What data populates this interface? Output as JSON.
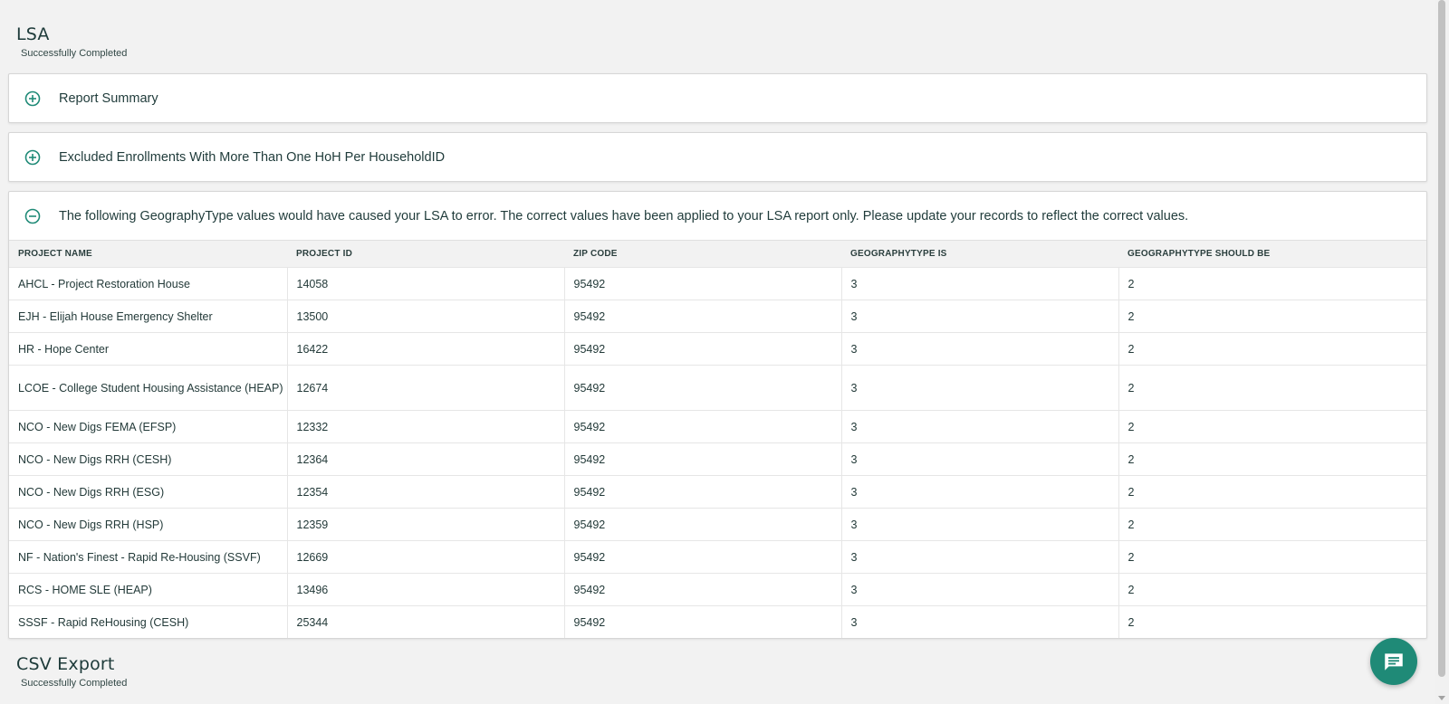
{
  "lsa": {
    "title": "LSA",
    "status": "Successfully Completed"
  },
  "panels": {
    "report_summary": {
      "title": "Report Summary",
      "expanded": false
    },
    "excluded": {
      "title": "Excluded Enrollments With More Than One HoH Per HouseholdID",
      "expanded": false
    },
    "geography": {
      "title": "The following GeographyType values would have caused your LSA to error. The correct values have been applied to your LSA report only. Please update your records to reflect the correct values.",
      "expanded": true
    }
  },
  "table": {
    "headers": [
      "PROJECT NAME",
      "PROJECT ID",
      "ZIP CODE",
      "GEOGRAPHYTYPE IS",
      "GEOGRAPHYTYPE SHOULD BE"
    ],
    "rows": [
      [
        "AHCL - Project Restoration House",
        "14058",
        "95492",
        "3",
        "2"
      ],
      [
        "EJH - Elijah House Emergency Shelter",
        "13500",
        "95492",
        "3",
        "2"
      ],
      [
        "HR - Hope Center",
        "16422",
        "95492",
        "3",
        "2"
      ],
      [
        "LCOE - College Student Housing Assistance (HEAP)",
        "12674",
        "95492",
        "3",
        "2"
      ],
      [
        "NCO - New Digs FEMA (EFSP)",
        "12332",
        "95492",
        "3",
        "2"
      ],
      [
        "NCO - New Digs RRH (CESH)",
        "12364",
        "95492",
        "3",
        "2"
      ],
      [
        "NCO - New Digs RRH (ESG)",
        "12354",
        "95492",
        "3",
        "2"
      ],
      [
        "NCO - New Digs RRH (HSP)",
        "12359",
        "95492",
        "3",
        "2"
      ],
      [
        "NF - Nation's Finest - Rapid Re-Housing (SSVF)",
        "12669",
        "95492",
        "3",
        "2"
      ],
      [
        "RCS - HOME SLE (HEAP)",
        "13496",
        "95492",
        "3",
        "2"
      ],
      [
        "SSSF - Rapid ReHousing (CESH)",
        "25344",
        "95492",
        "3",
        "2"
      ]
    ]
  },
  "csv_export": {
    "title": "CSV Export",
    "status": "Successfully Completed"
  },
  "icons": {
    "expand": "plus-circle-icon",
    "collapse": "minus-circle-icon",
    "chat": "chat-icon"
  },
  "colors": {
    "accent": "#1f8a77",
    "background": "#f2f2f2",
    "panel": "#ffffff",
    "text": "#1f3b3a"
  }
}
